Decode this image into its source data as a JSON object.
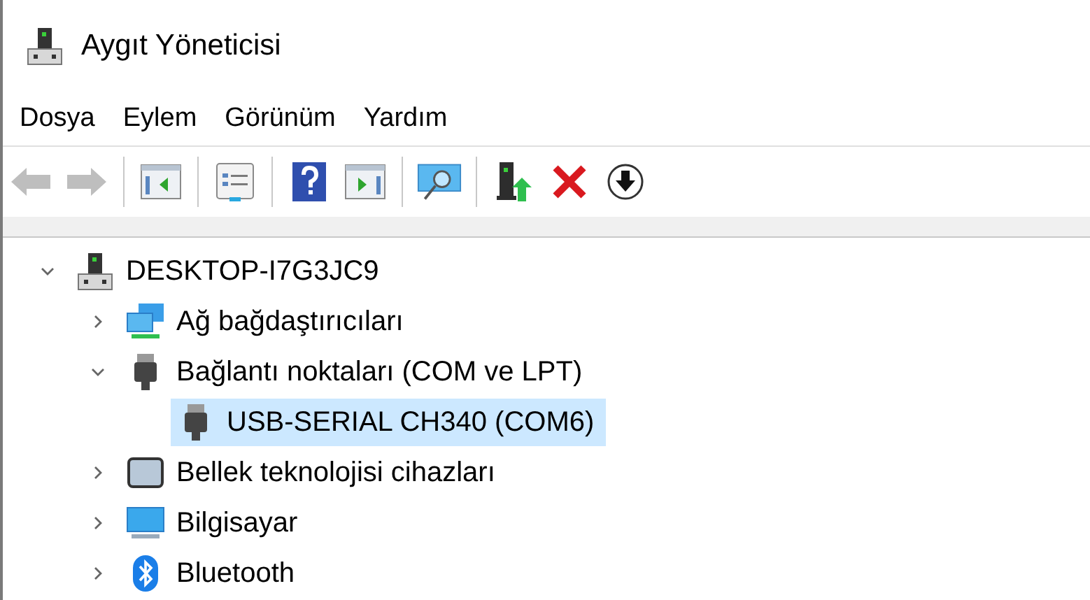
{
  "window": {
    "title": "Aygıt Yöneticisi"
  },
  "menu": [
    {
      "label": "Dosya"
    },
    {
      "label": "Eylem"
    },
    {
      "label": "Görünüm"
    },
    {
      "label": "Yardım"
    }
  ],
  "toolbar": [
    [
      {
        "kind": "back",
        "disabled": true
      },
      {
        "kind": "forward",
        "disabled": true
      }
    ],
    [
      {
        "kind": "console-tree",
        "disabled": false
      }
    ],
    [
      {
        "kind": "properties",
        "disabled": false
      }
    ],
    [
      {
        "kind": "help",
        "disabled": false
      },
      {
        "kind": "action-pane",
        "disabled": false
      }
    ],
    [
      {
        "kind": "scan",
        "disabled": false
      }
    ],
    [
      {
        "kind": "update",
        "disabled": false
      },
      {
        "kind": "uninstall",
        "disabled": false
      },
      {
        "kind": "disable",
        "disabled": false
      }
    ]
  ],
  "tree": [
    {
      "label": "DESKTOP-I7G3JC9",
      "kind": "computer",
      "expanded": true,
      "selected": false,
      "children": [
        {
          "label": "Ağ bağdaştırıcıları",
          "kind": "network",
          "expanded": false,
          "selected": false
        },
        {
          "label": "Bağlantı noktaları (COM ve LPT)",
          "kind": "port",
          "expanded": true,
          "selected": false,
          "children": [
            {
              "label": "USB-SERIAL CH340 (COM6)",
              "kind": "port",
              "selected": true
            }
          ]
        },
        {
          "label": "Bellek teknolojisi cihazları",
          "kind": "memory",
          "expanded": false,
          "selected": false
        },
        {
          "label": "Bilgisayar",
          "kind": "monitor",
          "expanded": false,
          "selected": false
        },
        {
          "label": "Bluetooth",
          "kind": "bluetooth",
          "expanded": false,
          "selected": false
        }
      ]
    }
  ]
}
